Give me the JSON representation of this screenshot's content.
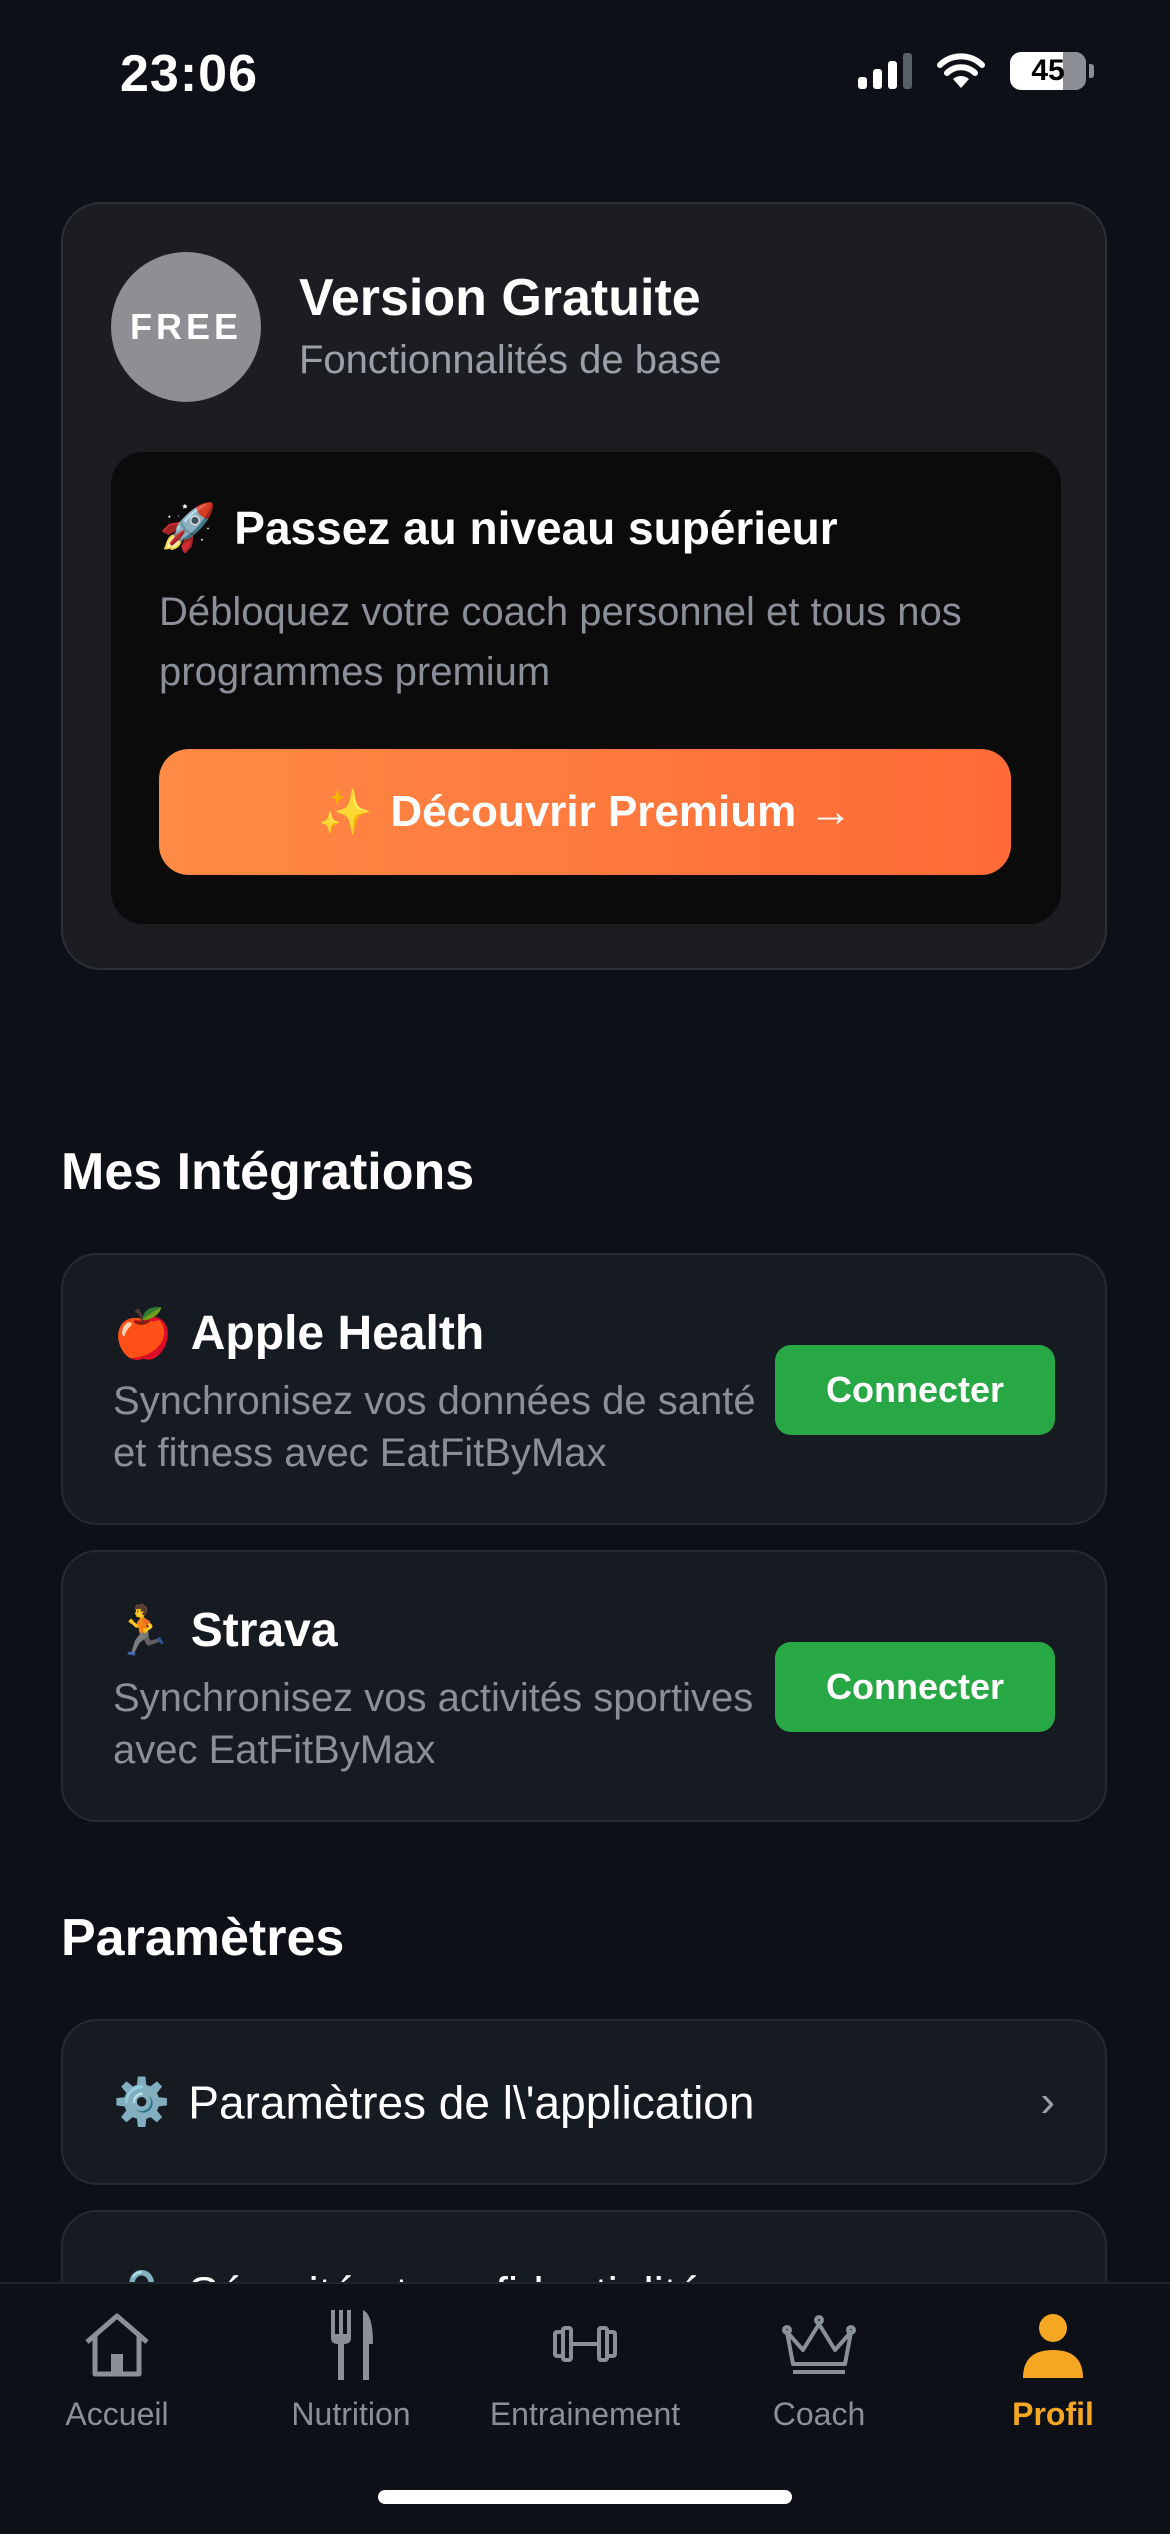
{
  "status": {
    "time": "23:06",
    "battery": "45"
  },
  "plan": {
    "badge": "FREE",
    "title": "Version Gratuite",
    "subtitle": "Fonctionnalités de base",
    "upgrade_emoji": "🚀",
    "upgrade_title": "Passez au niveau supérieur",
    "upgrade_desc": "Débloquez votre coach personnel et tous nos programmes premium",
    "cta_emoji": "✨",
    "cta_label": "Découvrir Premium →",
    "cta_color": "#ff7a3d"
  },
  "integrations": {
    "title": "Mes Intégrations",
    "items": [
      {
        "emoji": "🍎",
        "name": "Apple Health",
        "desc": "Synchronisez vos données de santé et fitness avec EatFitByMax",
        "button": "Connecter"
      },
      {
        "emoji": "🏃",
        "name": "Strava",
        "desc": "Synchronisez vos activités sportives avec EatFitByMax",
        "button": "Connecter"
      }
    ],
    "button_color": "#28a745"
  },
  "settings": {
    "title": "Paramètres",
    "items": [
      {
        "emoji": "⚙️",
        "label": "Paramètres de l\\'application"
      },
      {
        "emoji": "🔒",
        "label": "Sécurité et confidentialité"
      }
    ]
  },
  "tabs": [
    {
      "label": "Accueil",
      "icon": "house-icon"
    },
    {
      "label": "Nutrition",
      "icon": "fork-knife-icon"
    },
    {
      "label": "Entrainement",
      "icon": "dumbbell-icon"
    },
    {
      "label": "Coach",
      "icon": "crown-icon"
    },
    {
      "label": "Profil",
      "icon": "person-icon",
      "active": true
    }
  ],
  "colors": {
    "background": "#0d1117",
    "active_tab": "#f5a623"
  }
}
